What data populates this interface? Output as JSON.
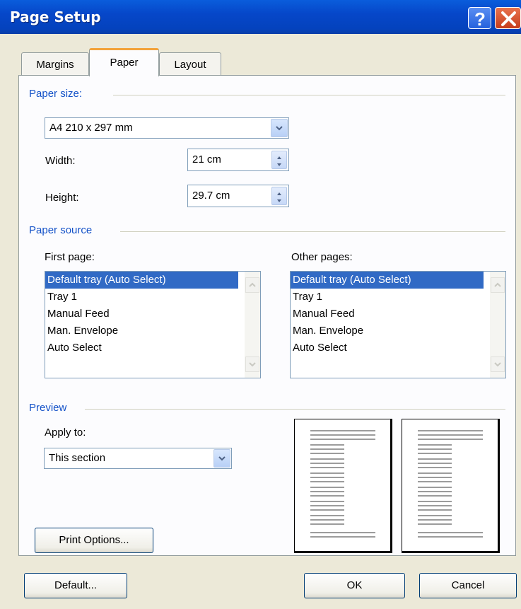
{
  "window": {
    "title": "Page Setup"
  },
  "tabs": [
    {
      "label": "Margins"
    },
    {
      "label": "Paper"
    },
    {
      "label": "Layout"
    }
  ],
  "paper_size": {
    "group_label": "Paper size:",
    "value": "A4 210 x 297 mm",
    "width_label": "Width:",
    "width_value": "21 cm",
    "height_label": "Height:",
    "height_value": "29.7 cm"
  },
  "paper_source": {
    "group_label": "Paper source",
    "first_page_label": "First page:",
    "other_pages_label": "Other pages:",
    "items": [
      "Default tray (Auto Select)",
      "Tray 1",
      "Manual Feed",
      "Man. Envelope",
      "Auto Select"
    ],
    "selected_index": 0
  },
  "preview": {
    "group_label": "Preview",
    "apply_to_label": "Apply to:",
    "apply_to_value": "This section",
    "print_options_label": "Print Options..."
  },
  "footer": {
    "default_label": "Default...",
    "ok_label": "OK",
    "cancel_label": "Cancel"
  },
  "colors": {
    "titlebar": "#0a5ddc",
    "selection": "#316ac5",
    "group_label": "#1452c8",
    "tab_highlight": "#f3a23a"
  }
}
